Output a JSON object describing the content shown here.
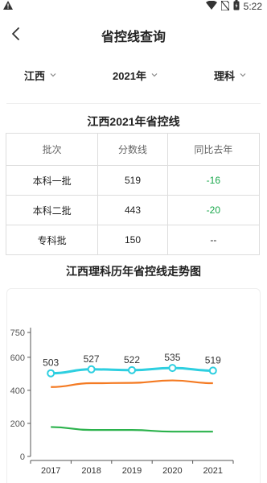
{
  "status_bar": {
    "time": "5:22"
  },
  "header": {
    "title": "省控线查询"
  },
  "filters": {
    "province": "江西",
    "year": "2021年",
    "subject": "理科"
  },
  "table": {
    "title": "江西2021年省控线",
    "headers": [
      "批次",
      "分数线",
      "同比去年"
    ],
    "rows": [
      {
        "batch": "本科一批",
        "score": "519",
        "change": "-16"
      },
      {
        "batch": "本科二批",
        "score": "443",
        "change": "-20"
      },
      {
        "batch": "专科批",
        "score": "150",
        "change": "--"
      }
    ]
  },
  "chart_section": {
    "title": "江西理科历年省控线走势图"
  },
  "colors": {
    "series_1": "#2ecfe0",
    "series_2": "#f47a22",
    "series_3": "#2bb24c",
    "change_text": "#19a84b"
  },
  "chart_data": {
    "type": "line",
    "title": "江西理科历年省控线走势图",
    "categories": [
      "2017",
      "2018",
      "2019",
      "2020",
      "2021"
    ],
    "yticks": [
      0,
      200,
      400,
      600,
      750
    ],
    "ylim": [
      0,
      750
    ],
    "series": [
      {
        "values": [
          503,
          527,
          522,
          535,
          519
        ],
        "labels": [
          "503",
          "527",
          "522",
          "535",
          "519"
        ]
      },
      {
        "values": [
          420,
          443,
          445,
          460,
          443
        ]
      },
      {
        "values": [
          178,
          160,
          160,
          150,
          150
        ]
      }
    ],
    "legend": "none",
    "grid": false
  }
}
